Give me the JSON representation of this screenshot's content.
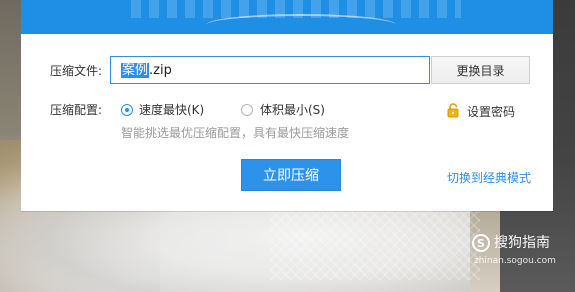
{
  "form": {
    "file_label": "压缩文件:",
    "file_name_selected": "案例",
    "file_name_rest": ".zip",
    "change_dir_label": "更换目录",
    "config_label": "压缩配置:",
    "option_fastest": "速度最快(K)",
    "option_smallest": "体积最小(S)",
    "hint": "智能挑选最优压缩配置，具有最快压缩速度",
    "set_password": "设置密码",
    "compress_now": "立即压缩",
    "switch_mode": "切换到经典模式"
  },
  "state": {
    "selected_option": "option_fastest"
  },
  "watermark": {
    "badge_letter": "S",
    "title": "搜狗指南",
    "subtitle": "zhinan.sogou.com"
  },
  "icons": {
    "lock": "lock-icon",
    "watermark_badge": "sogou-badge-icon"
  },
  "colors": {
    "accent": "#2e8ee8",
    "header": "#1f8fe6",
    "hint": "#9a9a9a"
  }
}
